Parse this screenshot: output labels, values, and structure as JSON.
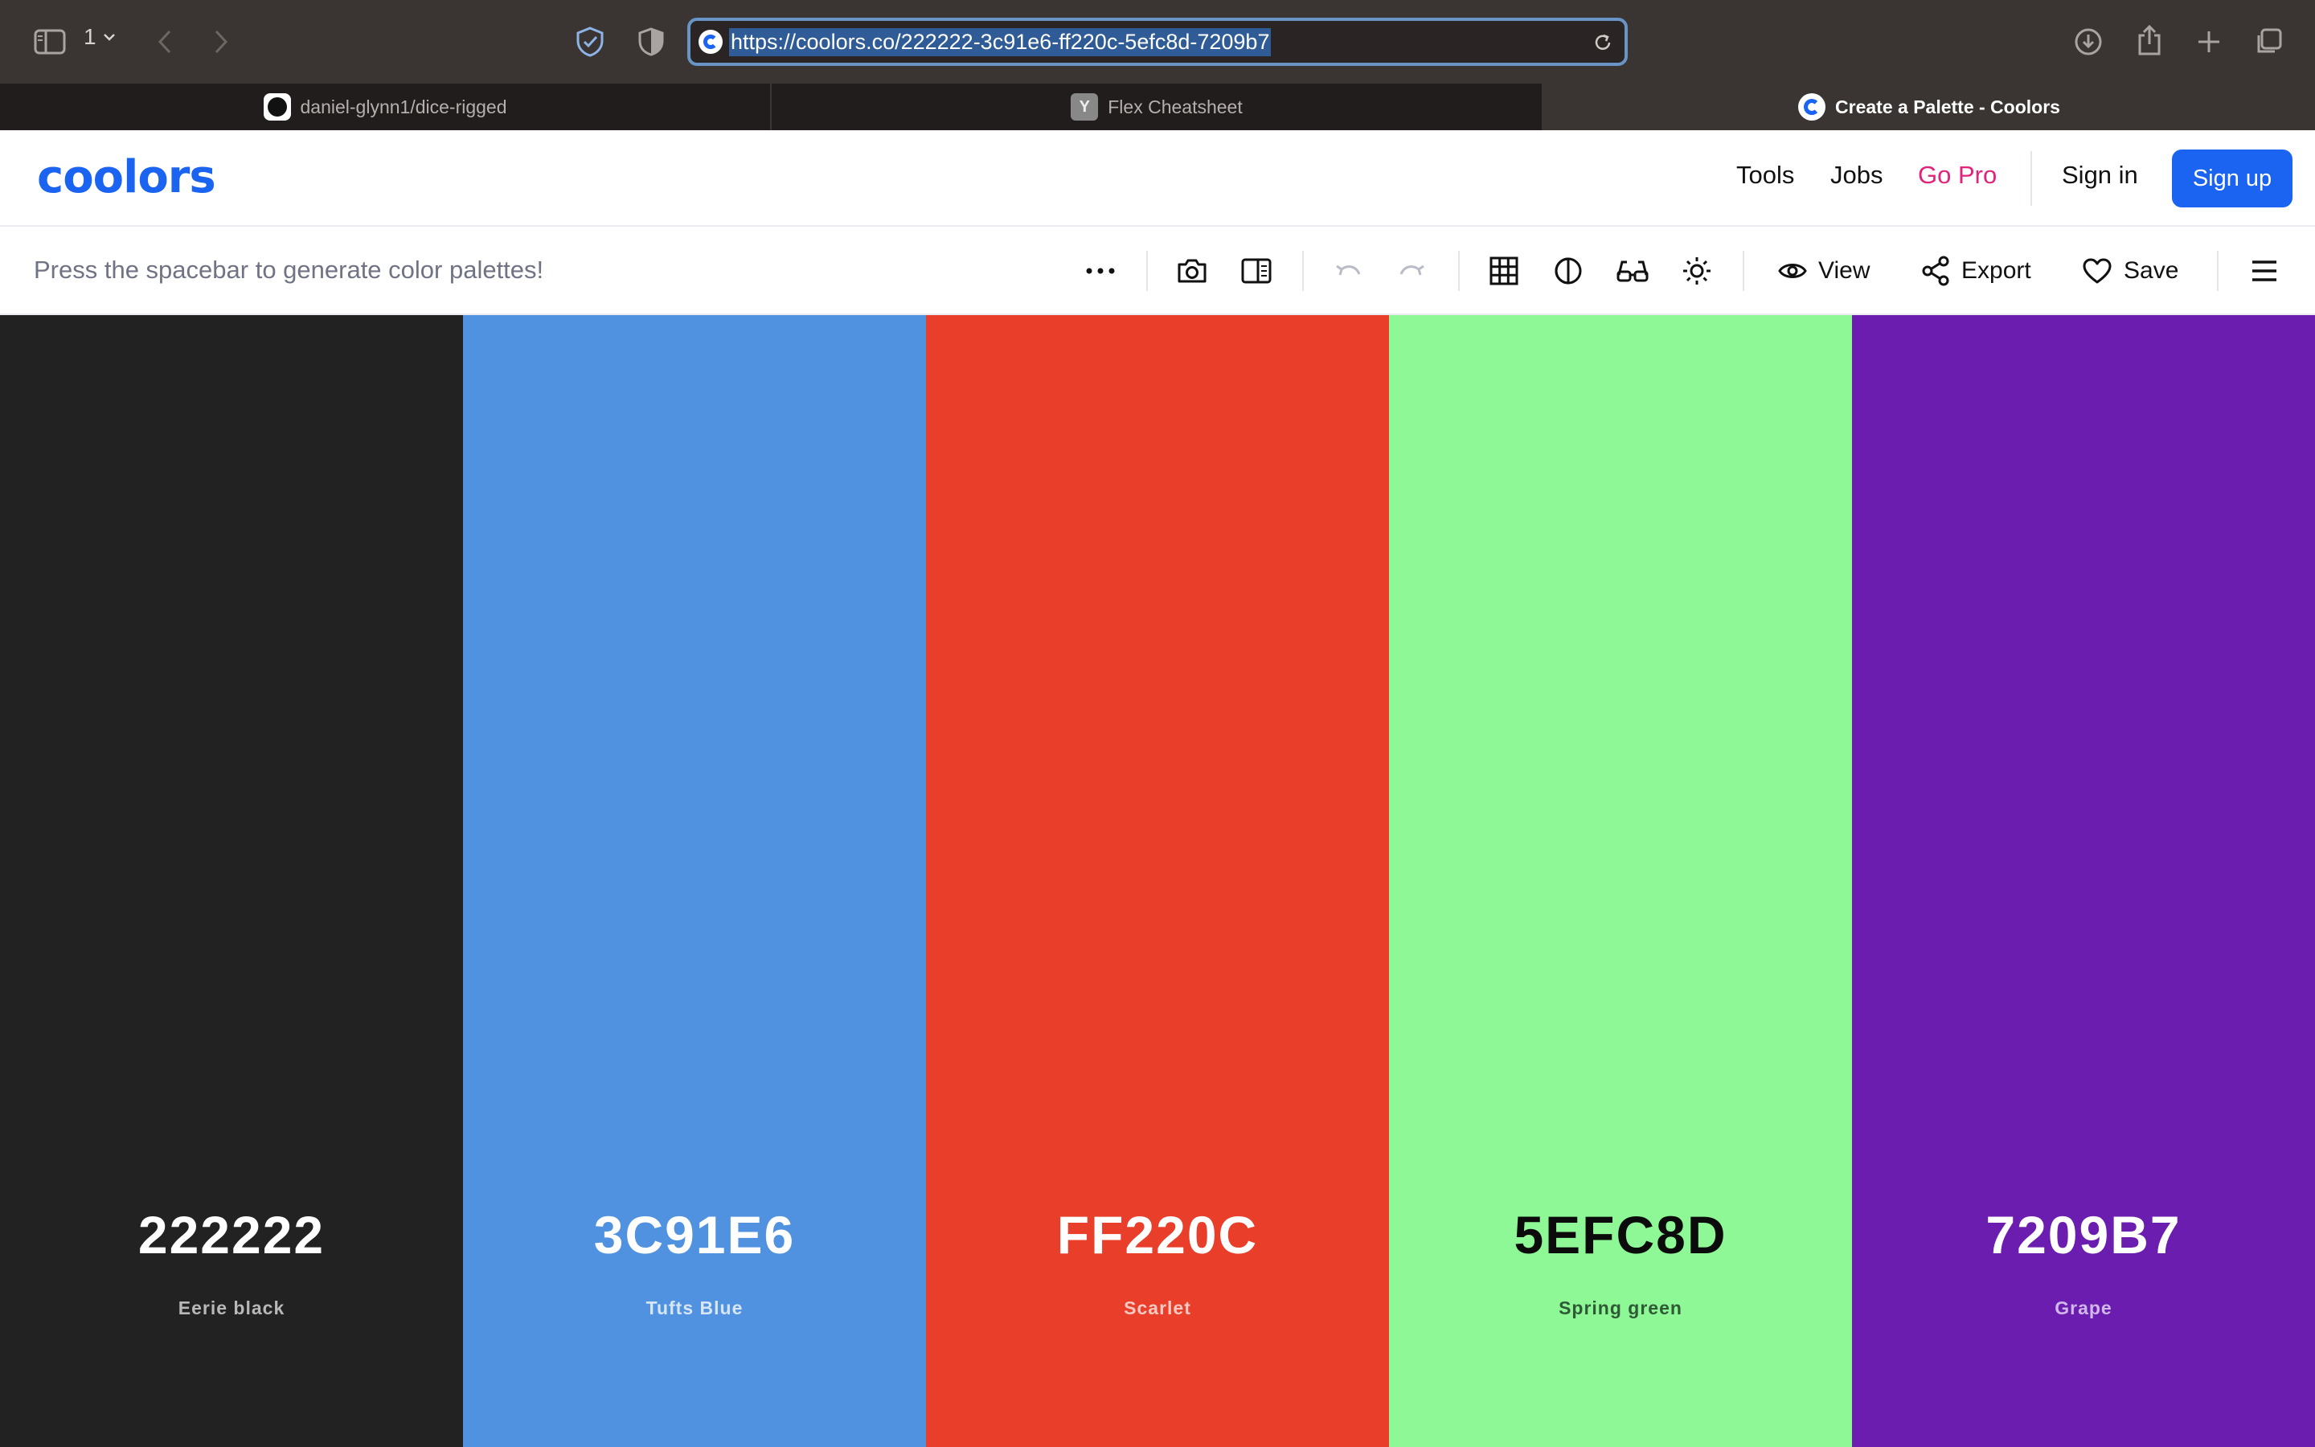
{
  "browser": {
    "tab_count": "1",
    "url": "https://coolors.co/222222-3c91e6-ff220c-5efc8d-7209b7",
    "tabs": [
      {
        "title": "daniel-glynn1/dice-rigged",
        "favicon": "github-icon",
        "active": false
      },
      {
        "title": "Flex Cheatsheet",
        "favicon": "y-icon",
        "favicon_letter": "Y",
        "active": false
      },
      {
        "title": "Create a Palette - Coolors",
        "favicon": "coolors-icon",
        "active": true
      }
    ]
  },
  "site": {
    "logo": "coolors",
    "nav": {
      "tools": "Tools",
      "jobs": "Jobs",
      "go_pro": "Go Pro",
      "sign_in": "Sign in",
      "sign_up": "Sign up"
    },
    "colors": {
      "brand": "#1b64f2",
      "pro": "#e0247b"
    }
  },
  "toolbar": {
    "hint": "Press the spacebar to generate color palettes!",
    "view": "View",
    "export": "Export",
    "save": "Save"
  },
  "palette": [
    {
      "hex": "222222",
      "name": "Eerie black",
      "bg": "#222222",
      "fg": "#ffffff",
      "name_color": "#b8b8b8"
    },
    {
      "hex": "3C91E6",
      "name": "Tufts Blue",
      "bg": "#5192e0",
      "fg": "#ffffff",
      "name_color": "#d6e6f7"
    },
    {
      "hex": "FF220C",
      "name": "Scarlet",
      "bg": "#e83e2a",
      "fg": "#ffffff",
      "name_color": "#f9c9c2"
    },
    {
      "hex": "5EFC8D",
      "name": "Spring green",
      "bg": "#8ef897",
      "fg": "#0b0b0b",
      "name_color": "#2f5a36"
    },
    {
      "hex": "7209B7",
      "name": "Grape",
      "bg": "#6a1daf",
      "fg": "#ffffff",
      "name_color": "#d1b7ea"
    }
  ]
}
